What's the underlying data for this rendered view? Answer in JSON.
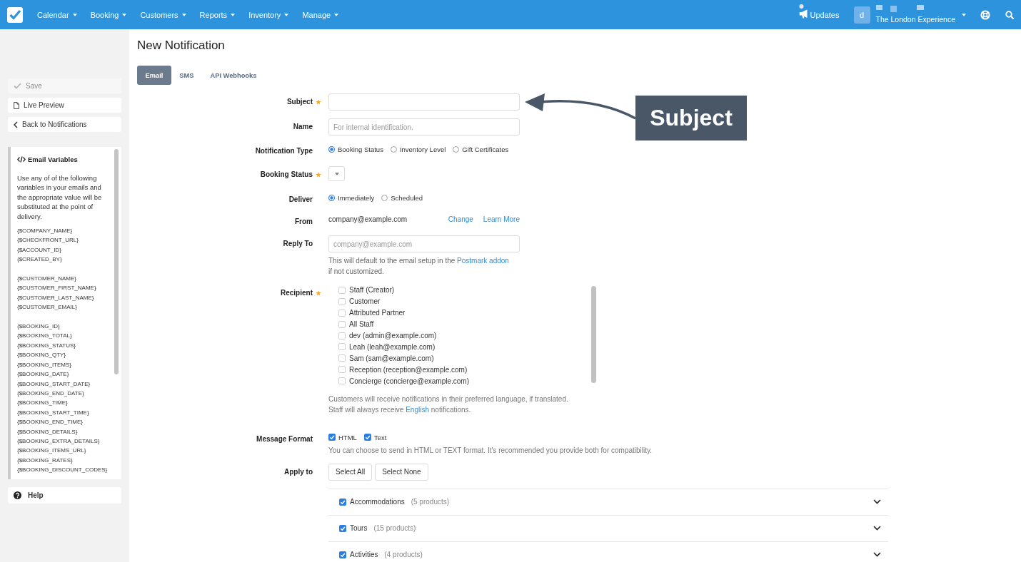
{
  "nav": {
    "items": [
      "Calendar",
      "Booking",
      "Customers",
      "Reports",
      "Inventory",
      "Manage"
    ],
    "updates": "Updates",
    "avatar": "d",
    "account": "The London Experience"
  },
  "sidebar": {
    "actions": [
      {
        "kind": "save",
        "label": "Save",
        "disabled": true
      },
      {
        "kind": "preview",
        "label": "Live Preview",
        "disabled": false
      },
      {
        "kind": "back",
        "label": "Back to Notifications",
        "disabled": false
      }
    ],
    "variables": {
      "title": "Email Variables",
      "intro": "Use any of of the following variables in your emails and the appropriate value will be substituted at the point of delivery.",
      "groups": [
        [
          "{$COMPANY_NAME}",
          "{$CHECKFRONT_URL}",
          "{$ACCOUNT_ID}",
          "{$CREATED_BY}"
        ],
        [
          "{$CUSTOMER_NAME}",
          "{$CUSTOMER_FIRST_NAME}",
          "{$CUSTOMER_LAST_NAME}",
          "{$CUSTOMER_EMAIL}"
        ],
        [
          "{$BOOKING_ID}",
          "{$BOOKING_TOTAL}",
          "{$BOOKING_STATUS}",
          "{$BOOKING_QTY}",
          "{$BOOKING_ITEMS}",
          "{$BOOKING_DATE}",
          "{$BOOKING_START_DATE}",
          "{$BOOKING_END_DATE}",
          "{$BOOKING_TIME}",
          "{$BOOKING_START_TIME}",
          "{$BOOKING_END_TIME}",
          "{$BOOKING_DETAILS}",
          "{$BOOKING_EXTRA_DETAILS}",
          "{$BOOKING_ITEMS_URL}",
          "{$BOOKING_RATES}",
          "{$BOOKING_DISCOUNT_CODES}"
        ]
      ]
    },
    "help": "Help"
  },
  "page": {
    "title": "New Notification"
  },
  "tabs": [
    {
      "label": "Email",
      "selected": true
    },
    {
      "label": "SMS",
      "selected": false
    },
    {
      "label": "API Webhooks",
      "selected": false
    }
  ],
  "form": {
    "fields": [
      {
        "kind": "text",
        "label": "Subject",
        "required": true
      },
      {
        "kind": "text",
        "label": "Name",
        "required": false,
        "placeholder": "For internal identification."
      },
      {
        "kind": "radio",
        "label": "Notification Type",
        "required": false,
        "options": [
          {
            "label": "Booking Status",
            "selected": true
          },
          {
            "label": "Inventory Level",
            "selected": false
          },
          {
            "label": "Gift Certificates",
            "selected": false
          }
        ]
      },
      {
        "kind": "select",
        "label": "Booking Status",
        "required": true
      },
      {
        "kind": "radio",
        "label": "Deliver",
        "required": false,
        "options": [
          {
            "label": "Immediately",
            "selected": true
          },
          {
            "label": "Scheduled",
            "selected": false
          }
        ]
      },
      {
        "kind": "static",
        "label": "From",
        "required": false,
        "value": "company@example.com",
        "links": [
          "Change",
          "Learn More"
        ]
      },
      {
        "kind": "text",
        "label": "Reply To",
        "required": false,
        "placeholder": "company@example.com",
        "help": [
          [
            {
              "kind": "text",
              "text": "This will default to the email setup in the"
            },
            {
              "kind": "link",
              "text": "Postmark addon"
            }
          ],
          [
            {
              "kind": "text",
              "text": "if not customized."
            }
          ]
        ]
      },
      {
        "kind": "checklist",
        "label": "Recipient",
        "required": true,
        "options": [
          {
            "label": "Staff (Creator)",
            "checked": false
          },
          {
            "label": "Customer",
            "checked": false
          },
          {
            "label": "Attributed Partner",
            "checked": false
          },
          {
            "label": "All Staff",
            "checked": false
          },
          {
            "label": "dev (admin@example.com)",
            "checked": false
          },
          {
            "label": "Leah (leah@example.com)",
            "checked": false
          },
          {
            "label": "Sam (sam@example.com)",
            "checked": false
          },
          {
            "label": "Reception (reception@example.com)",
            "checked": false
          },
          {
            "label": "Concierge (concierge@example.com)",
            "checked": false
          }
        ],
        "note": [
          [
            {
              "kind": "text",
              "text": "Customers will receive notifications in their preferred language, if translated."
            }
          ],
          [
            {
              "kind": "text",
              "text": "Staff will always receive"
            },
            {
              "kind": "link",
              "text": "English"
            },
            {
              "kind": "text",
              "text": "notifications."
            }
          ]
        ]
      },
      {
        "kind": "checkboxes",
        "label": "Message Format",
        "required": false,
        "options": [
          {
            "label": "HTML",
            "checked": true
          },
          {
            "label": "Text",
            "checked": true
          }
        ],
        "note": "You can choose to send in HTML or TEXT format. It's recommended you provide both for compatibility."
      },
      {
        "kind": "apply",
        "label": "Apply to",
        "required": false,
        "buttons": [
          "Select All",
          "Select None"
        ],
        "groups": [
          {
            "name": "Accommodations",
            "count": "(5 products)",
            "checked": true,
            "expanded": false
          },
          {
            "name": "Tours",
            "count": "(15 products)",
            "checked": true,
            "expanded": false
          },
          {
            "name": "Activities",
            "count": "(4 products)",
            "checked": true,
            "expanded": false
          }
        ]
      }
    ]
  },
  "callout": {
    "label": "Subject"
  }
}
